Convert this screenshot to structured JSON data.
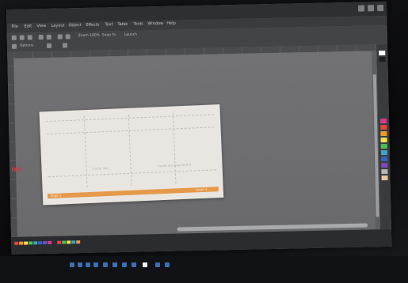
{
  "app": {
    "menu": [
      "File",
      "Edit",
      "View",
      "Layout",
      "Object",
      "Effects",
      "Text",
      "Table",
      "Tools",
      "Window",
      "Help"
    ],
    "toolbar_labels": [
      "Zoom 100%",
      "Snap To",
      "Launch",
      "Options"
    ],
    "status": {
      "left_text": "",
      "right_text": ""
    },
    "page_marker": "no"
  },
  "document": {
    "text_left": "Guide line",
    "text_right": "Guide line placement",
    "footer_left": "Page 1",
    "footer_right": "Layer 1"
  },
  "colors": {
    "accent": "#e49a4a",
    "canvas": "#6e6e70",
    "page": "#e9e6e1",
    "marker": "#d8373a"
  },
  "icons": [
    "window-minimize-icon",
    "window-maximize-icon",
    "window-close-icon",
    "color-palette-icon",
    "taskbar-app-icon"
  ]
}
